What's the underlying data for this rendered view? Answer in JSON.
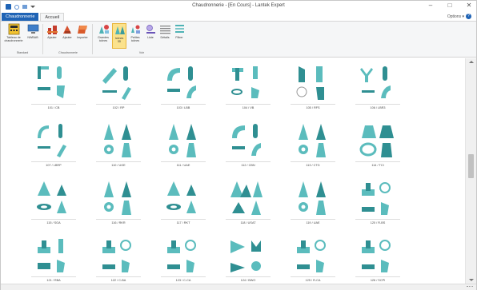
{
  "window": {
    "title": "Chaudronnerie - [En Cours] - Lantek Expert",
    "controls": [
      "–",
      "□",
      "✕"
    ]
  },
  "tabs": [
    {
      "label": "Chaudronnerie",
      "kind": "file"
    },
    {
      "label": "Accueil",
      "kind": "active"
    }
  ],
  "options_label": "Options ▾",
  "help_label": "?",
  "ribbon": {
    "buttons": [
      {
        "label": "Tableau de chaudronnerie",
        "icon": "grid-table-icon"
      },
      {
        "label": "NWBAB",
        "icon": "monitor-icon"
      },
      {
        "label": "Ajouter",
        "icon": "add-part-icon"
      },
      {
        "label": "Ajouter",
        "icon": "add-shape-icon"
      },
      {
        "label": "Importer",
        "icon": "import-icon"
      },
      {
        "label": "Grandes icônes",
        "icon": "large-icons-icon"
      },
      {
        "label": "Icônes 3D",
        "icon": "icons-3d-icon"
      },
      {
        "label": "Petites icônes",
        "icon": "small-icons-icon"
      },
      {
        "label": "Liste",
        "icon": "list-icon"
      },
      {
        "label": "Détails",
        "icon": "details-icon"
      },
      {
        "label": "Filtrer",
        "icon": "filter-icon"
      }
    ],
    "groups": [
      "Standard",
      "Chaudronnerie",
      "Voir"
    ]
  },
  "parts": [
    {
      "label": "101 / CB",
      "shape": "elbow-square"
    },
    {
      "label": "102 / RP",
      "shape": "pipe-diagonal"
    },
    {
      "label": "103 / LBB",
      "shape": "elbow-round"
    },
    {
      "label": "104 / VB",
      "shape": "branch-tee"
    },
    {
      "label": "105 / RFS",
      "shape": "cylinder-cut"
    },
    {
      "label": "106 / LBR3",
      "shape": "y-branch"
    },
    {
      "label": "107 / LBRP",
      "shape": "elbow-slim"
    },
    {
      "label": "110 / UGE",
      "shape": "cone-set"
    },
    {
      "label": "111 / UAE",
      "shape": "cone-set"
    },
    {
      "label": "112 / CBN",
      "shape": "elbow-round"
    },
    {
      "label": "113 / CTG",
      "shape": "cone-set"
    },
    {
      "label": "114 / TCI",
      "shape": "ring-set"
    },
    {
      "label": "115 / SGA",
      "shape": "cone-flat"
    },
    {
      "label": "116 / RKR",
      "shape": "cone-set"
    },
    {
      "label": "117 / RKT",
      "shape": "cone-flat"
    },
    {
      "label": "118 / USAT",
      "shape": "cone-double"
    },
    {
      "label": "119 / UAE",
      "shape": "cone-set"
    },
    {
      "label": "120 / R-BS",
      "shape": "tee-ring"
    },
    {
      "label": "121 / RBA",
      "shape": "tee-stack"
    },
    {
      "label": "122 / C-BA",
      "shape": "tee-ring"
    },
    {
      "label": "123 / C-CA",
      "shape": "tee-ring"
    },
    {
      "label": "124 / BWO",
      "shape": "v-branch"
    },
    {
      "label": "125 / R-CA",
      "shape": "tee-ring"
    },
    {
      "label": "126 / SCPI",
      "shape": "tee-ring"
    }
  ]
}
